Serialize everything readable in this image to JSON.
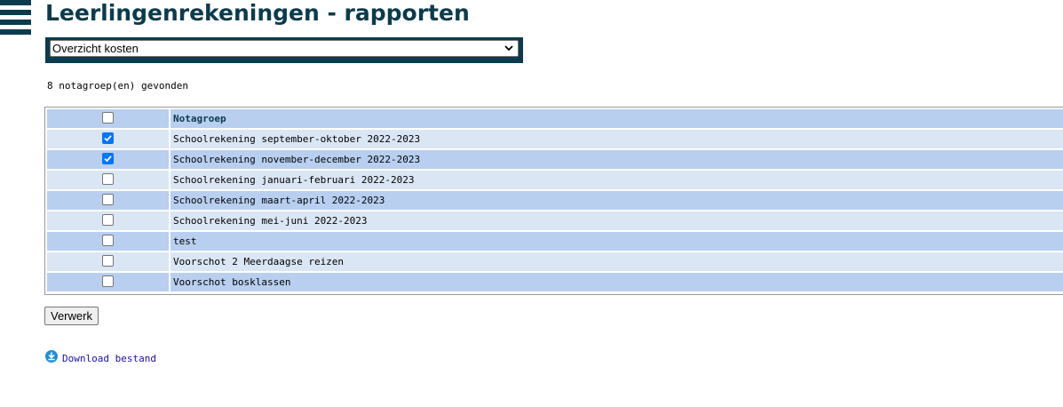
{
  "header": {
    "title": "Leerlingenrekeningen - rapporten",
    "menu_icon": "hamburger-menu-icon"
  },
  "report_select": {
    "selected": "Overzicht kosten"
  },
  "results": {
    "count_text": "8 notagroep(en) gevonden"
  },
  "table": {
    "header": {
      "column_label": "Notagroep",
      "select_all_checked": false
    },
    "rows": [
      {
        "label": "Schoolrekening september-oktober 2022-2023",
        "checked": true
      },
      {
        "label": "Schoolrekening november-december 2022-2023",
        "checked": true
      },
      {
        "label": "Schoolrekening januari-februari 2022-2023",
        "checked": false
      },
      {
        "label": "Schoolrekening maart-april 2022-2023",
        "checked": false
      },
      {
        "label": "Schoolrekening mei-juni 2022-2023",
        "checked": false
      },
      {
        "label": "test",
        "checked": false
      },
      {
        "label": "Voorschot 2 Meerdaagse reizen",
        "checked": false
      },
      {
        "label": "Voorschot bosklassen",
        "checked": false
      }
    ]
  },
  "actions": {
    "submit_label": "Verwerk",
    "download_label": "Download bestand",
    "download_icon": "download-circle-icon"
  },
  "colors": {
    "brand": "#0b3b4c",
    "row_dark": "#b8cff0",
    "row_light": "#dbe6f4",
    "checkbox_checked": "#0075ff",
    "link": "#1a0dab"
  }
}
